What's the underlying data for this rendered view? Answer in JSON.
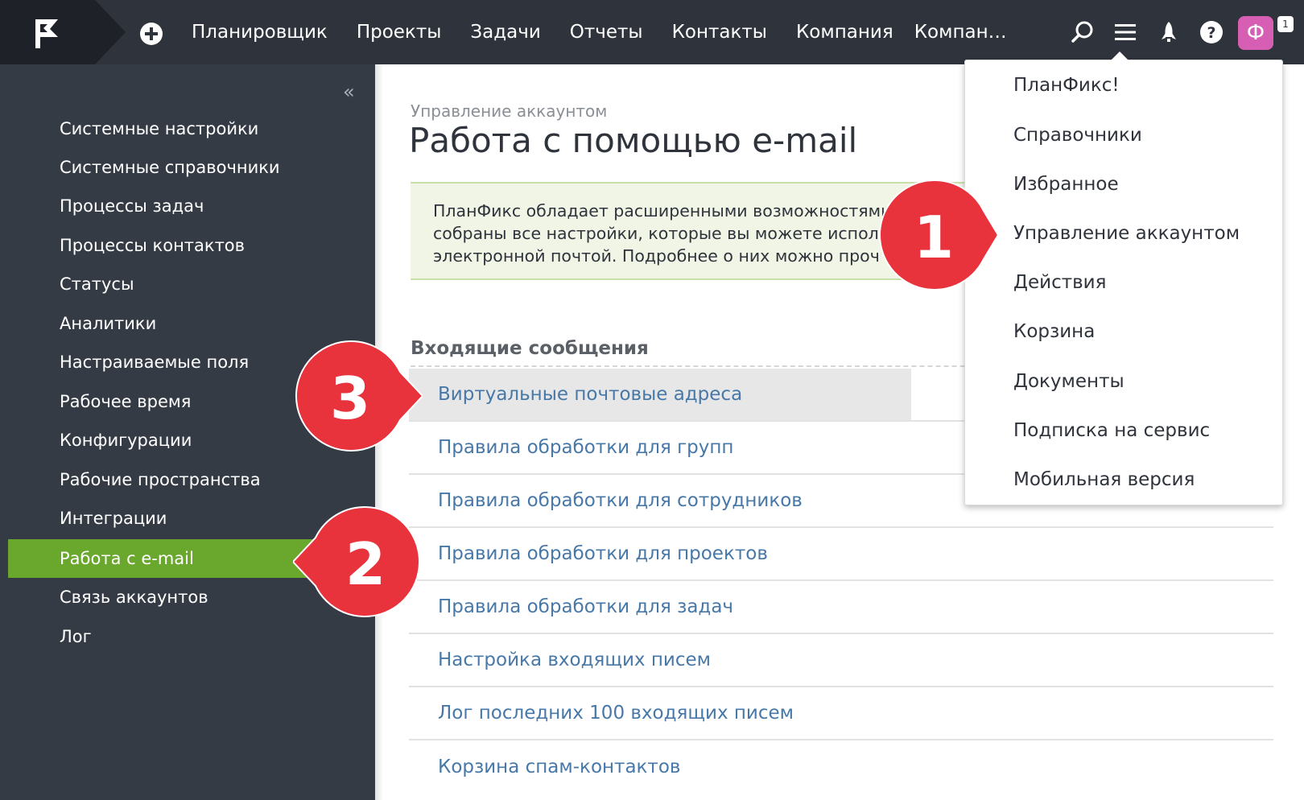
{
  "topbar": {
    "nav": [
      "Планировщик",
      "Проекты",
      "Задачи",
      "Отчеты",
      "Контакты",
      "Компания",
      "Компан…"
    ],
    "avatar_letter": "Ф",
    "notification_count": "1",
    "colors": {
      "bar": "#2f343c",
      "avatar": "#d75fb3"
    }
  },
  "sidebar": {
    "collapse_label": "«",
    "items": [
      "Системные настройки",
      "Системные справочники",
      "Процессы задач",
      "Процессы контактов",
      "Статусы",
      "Аналитики",
      "Настраиваемые поля",
      "Рабочее время",
      "Конфигурации",
      "Рабочие пространства",
      "Интеграции",
      "Работа с e-mail",
      "Связь аккаунтов",
      "Лог"
    ],
    "active_index": 11,
    "active_color": "#6aa72d"
  },
  "main": {
    "breadcrumb": "Управление аккаунтом",
    "title": "Работа с помощью e-mail",
    "info_lines": [
      "ПланФикс обладает расширенными возможностями",
      "собраны все настройки, которые вы можете испол",
      "электронной почтой. Подробнее о них можно проч"
    ],
    "section_title": "Входящие сообщения",
    "links": [
      "Виртуальные почтовые адреса",
      "Правила обработки для групп",
      "Правила обработки для сотрудников",
      "Правила обработки для проектов",
      "Правила обработки для задач",
      "Настройка входящих писем",
      "Лог последних 100 входящих писем",
      "Корзина спам-контактов"
    ],
    "link_color": "#4778a8"
  },
  "dropdown": {
    "items": [
      "ПланФикс!",
      "Справочники",
      "Избранное",
      "Управление аккаунтом",
      "Действия",
      "Корзина",
      "Документы",
      "Подписка на сервис",
      "Мобильная версия"
    ]
  },
  "steps": [
    "1",
    "2",
    "3"
  ],
  "step_color": "#e8323c"
}
